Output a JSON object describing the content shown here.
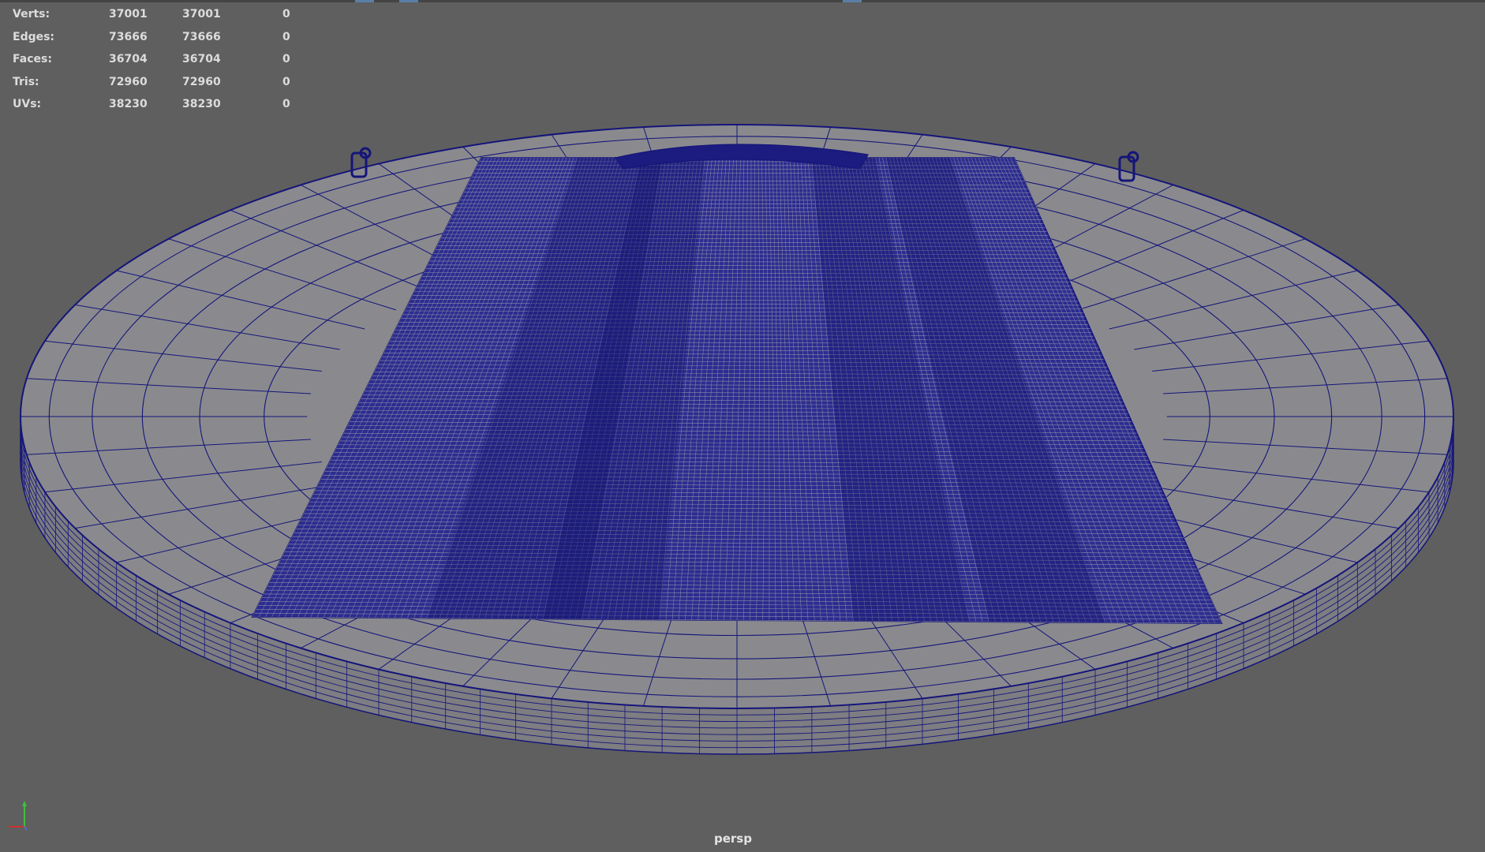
{
  "poly_count": [
    {
      "label": "Verts:",
      "a": "37001",
      "b": "37001",
      "c": "0"
    },
    {
      "label": "Edges:",
      "a": "73666",
      "b": "73666",
      "c": "0"
    },
    {
      "label": "Faces:",
      "a": "36704",
      "b": "36704",
      "c": "0"
    },
    {
      "label": "Tris:",
      "a": "72960",
      "b": "72960",
      "c": "0"
    },
    {
      "label": "UVs:",
      "a": "38230",
      "b": "38230",
      "c": "0"
    }
  ],
  "camera": "persp",
  "colors": {
    "background": "#5f5f5f",
    "wireframe": "#15157a",
    "surface": "#8a8a8e",
    "hud_text": "#dcdcdc",
    "axis_y": "#3fbf3f",
    "axis_x": "#d03030"
  }
}
